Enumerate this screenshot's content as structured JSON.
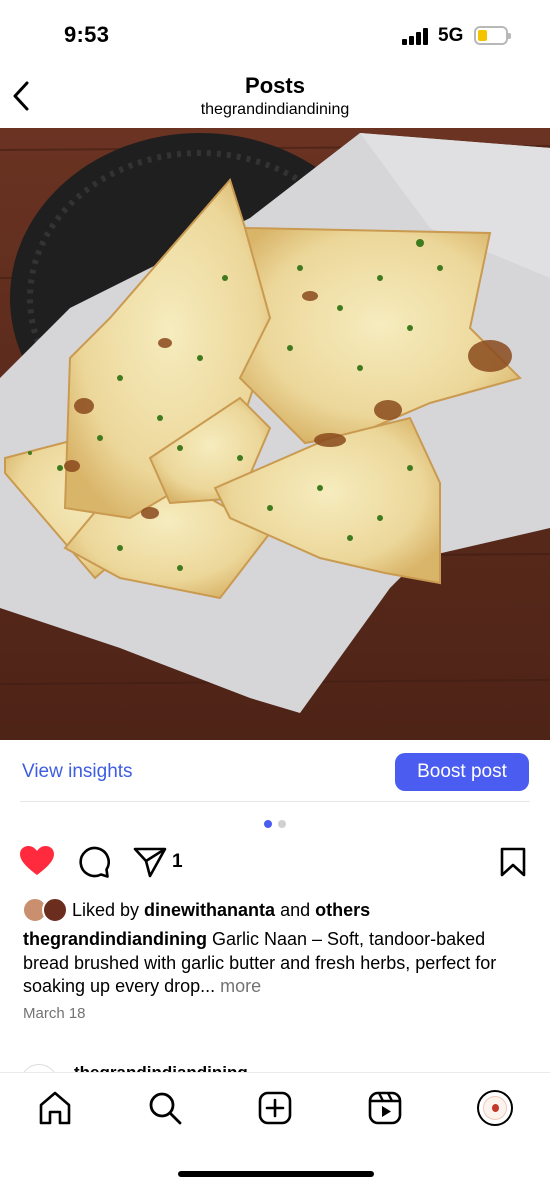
{
  "status_bar": {
    "time": "9:53",
    "network": "5G",
    "battery_color": "#f2c500"
  },
  "header": {
    "title": "Posts",
    "subtitle": "thegrandindiandining",
    "back_icon": "chevron-left-icon"
  },
  "post": {
    "image_alt_subject": "garlic naan in basket",
    "insights_label": "View insights",
    "boost_label": "Boost post",
    "carousel": {
      "count": 2,
      "active_index": 0,
      "active_color": "#4a5df0"
    },
    "actions": {
      "liked": true,
      "like_color": "#ff2a3d",
      "share_count": "1"
    },
    "likes": {
      "prefix": "Liked by ",
      "user": "dinewithananta",
      "middle": " and ",
      "others": "others"
    },
    "caption": {
      "username": "thegrandindiandining",
      "text": " Garlic Naan – Soft, tandoor-baked bread brushed with garlic butter and fresh herbs, perfect for soaking up every drop",
      "ellipsis": "...",
      "more": " more"
    },
    "date": "March 18"
  },
  "next_post": {
    "username": "thegrandindiandining"
  },
  "tab_bar": {
    "items": [
      "home-icon",
      "search-icon",
      "create-icon",
      "reels-icon",
      "profile-avatar"
    ]
  }
}
